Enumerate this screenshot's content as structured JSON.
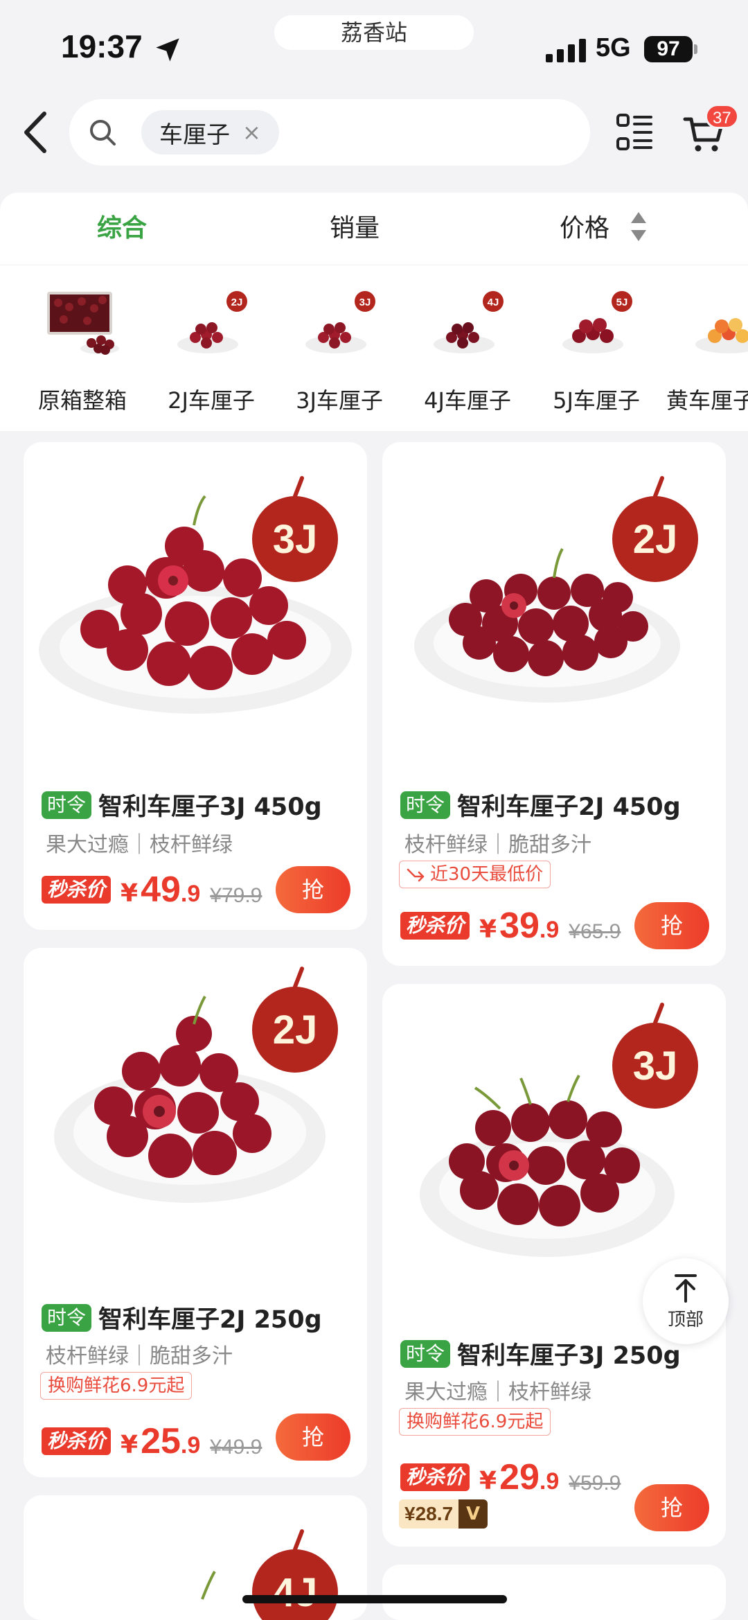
{
  "status_bar": {
    "time": "19:37",
    "app_island": "荔香站",
    "network": "5G",
    "battery": "97"
  },
  "search": {
    "chip_text": "车厘子",
    "chip_close": "×"
  },
  "cart": {
    "badge": "37"
  },
  "sort_tabs": [
    {
      "label": "综合",
      "active": true
    },
    {
      "label": "销量",
      "active": false
    },
    {
      "label": "价格",
      "active": false
    }
  ],
  "categories": [
    {
      "label": "原箱整箱",
      "badge": ""
    },
    {
      "label": "2J车厘子",
      "badge": "2J"
    },
    {
      "label": "3J车厘子",
      "badge": "3J"
    },
    {
      "label": "4J车厘子",
      "badge": "4J"
    },
    {
      "label": "5J车厘子",
      "badge": "5J"
    },
    {
      "label": "黄车厘子",
      "badge": ""
    }
  ],
  "products": [
    {
      "grade": "3J",
      "season_tag": "时令",
      "title": "智利车厘子3J 450g",
      "subtitle": "果大过瘾｜枝杆鲜绿",
      "promo": "",
      "flash_label": "秒杀价",
      "yen": "¥",
      "price_int": "49",
      "price_dec": ".9",
      "original_price": "¥79.9",
      "member_price": "",
      "grab": "抢"
    },
    {
      "grade": "2J",
      "season_tag": "时令",
      "title": "智利车厘子2J 450g",
      "subtitle": "枝杆鲜绿｜脆甜多汁",
      "promo": "近30天最低价",
      "flash_label": "秒杀价",
      "yen": "¥",
      "price_int": "39",
      "price_dec": ".9",
      "original_price": "¥65.9",
      "member_price": "",
      "grab": "抢"
    },
    {
      "grade": "2J",
      "season_tag": "时令",
      "title": "智利车厘子2J 250g",
      "subtitle": "枝杆鲜绿｜脆甜多汁",
      "promo": "换购鲜花6.9元起",
      "flash_label": "秒杀价",
      "yen": "¥",
      "price_int": "25",
      "price_dec": ".9",
      "original_price": "¥49.9",
      "member_price": "",
      "grab": "抢"
    },
    {
      "grade": "3J",
      "season_tag": "时令",
      "title": "智利车厘子3J 250g",
      "subtitle": "果大过瘾｜枝杆鲜绿",
      "promo": "换购鲜花6.9元起",
      "flash_label": "秒杀价",
      "yen": "¥",
      "price_int": "29",
      "price_dec": ".9",
      "original_price": "¥59.9",
      "member_price": "¥28.7",
      "grab": "抢"
    },
    {
      "grade": "4J"
    }
  ],
  "to_top": {
    "label": "顶部"
  },
  "colors": {
    "accent_green": "#3aa344",
    "price_red": "#e93a2b",
    "badge_red": "#f2473f",
    "apple_red": "#b3261e"
  },
  "icons": [
    "location-arrow-icon",
    "signal-icon",
    "back-icon",
    "search-icon",
    "close-icon",
    "list-icon",
    "cart-icon",
    "sort-arrows-icon",
    "arrow-up-icon",
    "down-trend-icon",
    "member-v-icon"
  ]
}
